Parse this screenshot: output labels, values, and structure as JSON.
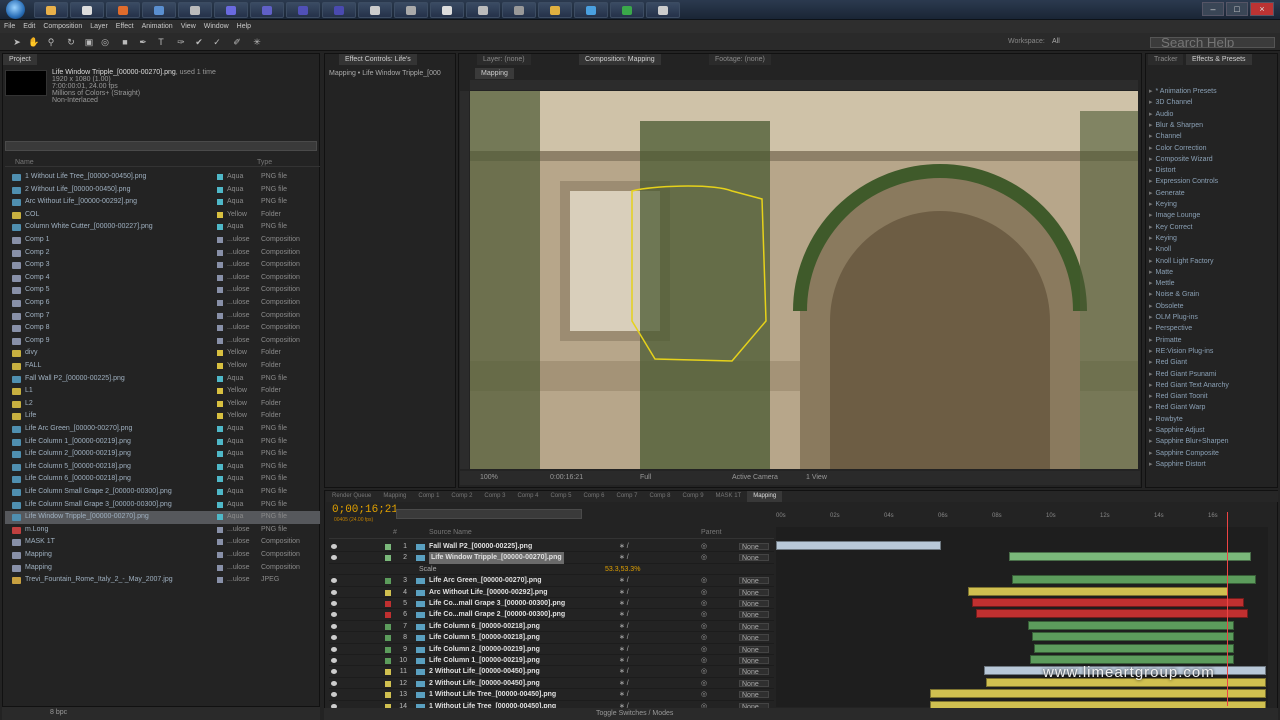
{
  "menu": [
    "File",
    "Edit",
    "Composition",
    "Layer",
    "Effect",
    "Animation",
    "View",
    "Window",
    "Help"
  ],
  "workspace": {
    "label": "Workspace:",
    "value": "All"
  },
  "search_help": {
    "placeholder": "Search Help"
  },
  "project": {
    "tab": "Project",
    "selected_name": "Life Window Tripple_[00000-00270].png",
    "used": ", used 1 time",
    "info_lines": [
      "1920 x 1080 (1.00)",
      "7:00:00:01, 24.00 fps",
      "Millions of Colors+ (Straight)",
      "Non-Interlaced"
    ],
    "columns": {
      "name": "Name",
      "type": "Type"
    },
    "rows": [
      {
        "name": "1 Without Life Tree_[00000-00450].png",
        "label": "Aqua",
        "type": "PNG file",
        "icon": "png"
      },
      {
        "name": "2 Without Life_[00000-00450].png",
        "label": "Aqua",
        "type": "PNG file",
        "icon": "png"
      },
      {
        "name": "Arc Without Life_[00000-00292].png",
        "label": "Aqua",
        "type": "PNG file",
        "icon": "png"
      },
      {
        "name": "COL",
        "label": "Yellow",
        "type": "Folder",
        "icon": "folder"
      },
      {
        "name": "Column White Cutter_[00000-00227].png",
        "label": "Aqua",
        "type": "PNG file",
        "icon": "png"
      },
      {
        "name": "Comp 1",
        "label": "...ulose",
        "type": "Composition",
        "icon": "comp"
      },
      {
        "name": "Comp 2",
        "label": "...ulose",
        "type": "Composition",
        "icon": "comp"
      },
      {
        "name": "Comp 3",
        "label": "...ulose",
        "type": "Composition",
        "icon": "comp"
      },
      {
        "name": "Comp 4",
        "label": "...ulose",
        "type": "Composition",
        "icon": "comp"
      },
      {
        "name": "Comp 5",
        "label": "...ulose",
        "type": "Composition",
        "icon": "comp"
      },
      {
        "name": "Comp 6",
        "label": "...ulose",
        "type": "Composition",
        "icon": "comp"
      },
      {
        "name": "Comp 7",
        "label": "...ulose",
        "type": "Composition",
        "icon": "comp"
      },
      {
        "name": "Comp 8",
        "label": "...ulose",
        "type": "Composition",
        "icon": "comp"
      },
      {
        "name": "Comp 9",
        "label": "...ulose",
        "type": "Composition",
        "icon": "comp"
      },
      {
        "name": "divy",
        "label": "Yellow",
        "type": "Folder",
        "icon": "folder"
      },
      {
        "name": "FALL",
        "label": "Yellow",
        "type": "Folder",
        "icon": "folder"
      },
      {
        "name": "Fall Wall P2_[00000-00225].png",
        "label": "Aqua",
        "type": "PNG file",
        "icon": "png"
      },
      {
        "name": "L1",
        "label": "Yellow",
        "type": "Folder",
        "icon": "folder"
      },
      {
        "name": "L2",
        "label": "Yellow",
        "type": "Folder",
        "icon": "folder"
      },
      {
        "name": "Life",
        "label": "Yellow",
        "type": "Folder",
        "icon": "folder"
      },
      {
        "name": "Life Arc Green_[00000-00270].png",
        "label": "Aqua",
        "type": "PNG file",
        "icon": "png"
      },
      {
        "name": "Life Column 1_[00000-00219].png",
        "label": "Aqua",
        "type": "PNG file",
        "icon": "png"
      },
      {
        "name": "Life Column 2_[00000-00219].png",
        "label": "Aqua",
        "type": "PNG file",
        "icon": "png"
      },
      {
        "name": "Life Column 5_[00000-00218].png",
        "label": "Aqua",
        "type": "PNG file",
        "icon": "png"
      },
      {
        "name": "Life Column 6_[00000-00218].png",
        "label": "Aqua",
        "type": "PNG file",
        "icon": "png"
      },
      {
        "name": "Life Column Small Grape 2_[00000-00300].png",
        "label": "Aqua",
        "type": "PNG file",
        "icon": "png"
      },
      {
        "name": "Life Column Small Grape 3_[00000-00300].png",
        "label": "Aqua",
        "type": "PNG file",
        "icon": "png"
      },
      {
        "name": "Life Window Tripple_[00000-00270].png",
        "label": "Aqua",
        "type": "PNG file",
        "icon": "png",
        "selected": true
      },
      {
        "name": "m.Long",
        "label": "...ulose",
        "type": "PNG file",
        "icon": "red"
      },
      {
        "name": "MASK 1T",
        "label": "...ulose",
        "type": "Composition",
        "icon": "comp"
      },
      {
        "name": "Mapping",
        "label": "...ulose",
        "type": "Composition",
        "icon": "comp"
      },
      {
        "name": "Mapping",
        "label": "...ulose",
        "type": "Composition",
        "icon": "comp"
      },
      {
        "name": "Trevi_Fountain_Rome_Italy_2_-_May_2007.jpg",
        "label": "...ulose",
        "type": "JPEG",
        "icon": "jpg"
      }
    ],
    "footer": "8 bpc"
  },
  "effect_controls": {
    "tab": "Effect Controls: Life's",
    "line": "Mapping • Life Window Tripple_[000"
  },
  "composition": {
    "tabs": [
      "Layer: (none)",
      "Composition: Mapping",
      "Footage: (none)"
    ],
    "subtab": "Mapping",
    "viewer_bar": [
      "100%",
      "0:00:16:21",
      "Full",
      "Active Camera",
      "1 View"
    ]
  },
  "effects_presets": {
    "tabs": [
      "Tracker",
      "Effects & Presets"
    ],
    "items": [
      "* Animation Presets",
      "3D Channel",
      "Audio",
      "Blur & Sharpen",
      "Channel",
      "Color Correction",
      "Composite Wizard",
      "Distort",
      "Expression Controls",
      "Generate",
      "Keying",
      "Image Lounge",
      "Key Correct",
      "Keying",
      "Knoll",
      "Knoll Light Factory",
      "Matte",
      "Mettle",
      "Noise & Grain",
      "Obsolete",
      "OLM Plug-ins",
      "Perspective",
      "Primatte",
      "RE:Vision Plug-ins",
      "Red Giant",
      "Red Giant Psunami",
      "Red Giant Text Anarchy",
      "Red Giant Toonit",
      "Red Giant Warp",
      "Rowbyte",
      "Sapphire Adjust",
      "Sapphire Blur+Sharpen",
      "Sapphire Composite",
      "Sapphire Distort"
    ]
  },
  "timeline": {
    "tabs": [
      "Render Queue",
      "Mapping",
      "Comp 1",
      "Comp 2",
      "Comp 3",
      "Comp 4",
      "Comp 5",
      "Comp 6",
      "Comp 7",
      "Comp 8",
      "Comp 9",
      "MASK 1T",
      "Mapping"
    ],
    "active_tab": "Mapping",
    "timecode": "0;00;16;21",
    "timecode_sub": "00405 (24.00 fps)",
    "columns": {
      "num": "#",
      "source": "Source Name",
      "parent": "Parent"
    },
    "ruler": [
      "00s",
      "02s",
      "04s",
      "06s",
      "08s",
      "10s",
      "12s",
      "14s",
      "16s"
    ],
    "layers": [
      {
        "n": "1",
        "name": "Fall Wall P2_[00000-00225].png",
        "color": "#7ab87a",
        "parent": "None"
      },
      {
        "n": "2",
        "name": "Life Window Tripple_[00000-00270].png",
        "color": "#7ab87a",
        "parent": "None",
        "selected": true
      },
      {
        "n": "",
        "name": "Scale",
        "color": "",
        "parent": "",
        "sub": true,
        "value": "53.3,53.3%"
      },
      {
        "n": "3",
        "name": "Life Arc Green_[00000-00270].png",
        "color": "#5c9c5c",
        "parent": "None"
      },
      {
        "n": "4",
        "name": "Arc Without Life_[00000-00292].png",
        "color": "#d0c050",
        "parent": "None"
      },
      {
        "n": "5",
        "name": "Life Co...mall Grape 3_[00000-00300].png",
        "color": "#c03030",
        "parent": "None"
      },
      {
        "n": "6",
        "name": "Life Co...mall Grape 2_[00000-00300].png",
        "color": "#c03030",
        "parent": "None"
      },
      {
        "n": "7",
        "name": "Life Column 6_[00000-00218].png",
        "color": "#5c9c5c",
        "parent": "None"
      },
      {
        "n": "8",
        "name": "Life Column 5_[00000-00218].png",
        "color": "#5c9c5c",
        "parent": "None"
      },
      {
        "n": "9",
        "name": "Life Column 2_[00000-00219].png",
        "color": "#5c9c5c",
        "parent": "None"
      },
      {
        "n": "10",
        "name": "Life Column 1_[00000-00219].png",
        "color": "#5c9c5c",
        "parent": "None"
      },
      {
        "n": "11",
        "name": "2 Without Life_[00000-00450].png",
        "color": "#d0c050",
        "parent": "None"
      },
      {
        "n": "12",
        "name": "2 Without Life_[00000-00450].png",
        "color": "#d0c050",
        "parent": "None"
      },
      {
        "n": "13",
        "name": "1 Without Life Tree_[00000-00450].png",
        "color": "#d0c050",
        "parent": "None"
      },
      {
        "n": "14",
        "name": "1 Without Life Tree_[00000-00450].png",
        "color": "#d0c050",
        "parent": "None"
      }
    ],
    "footer": "Toggle Switches / Modes"
  },
  "watermark": "www.limeartgroup.com"
}
